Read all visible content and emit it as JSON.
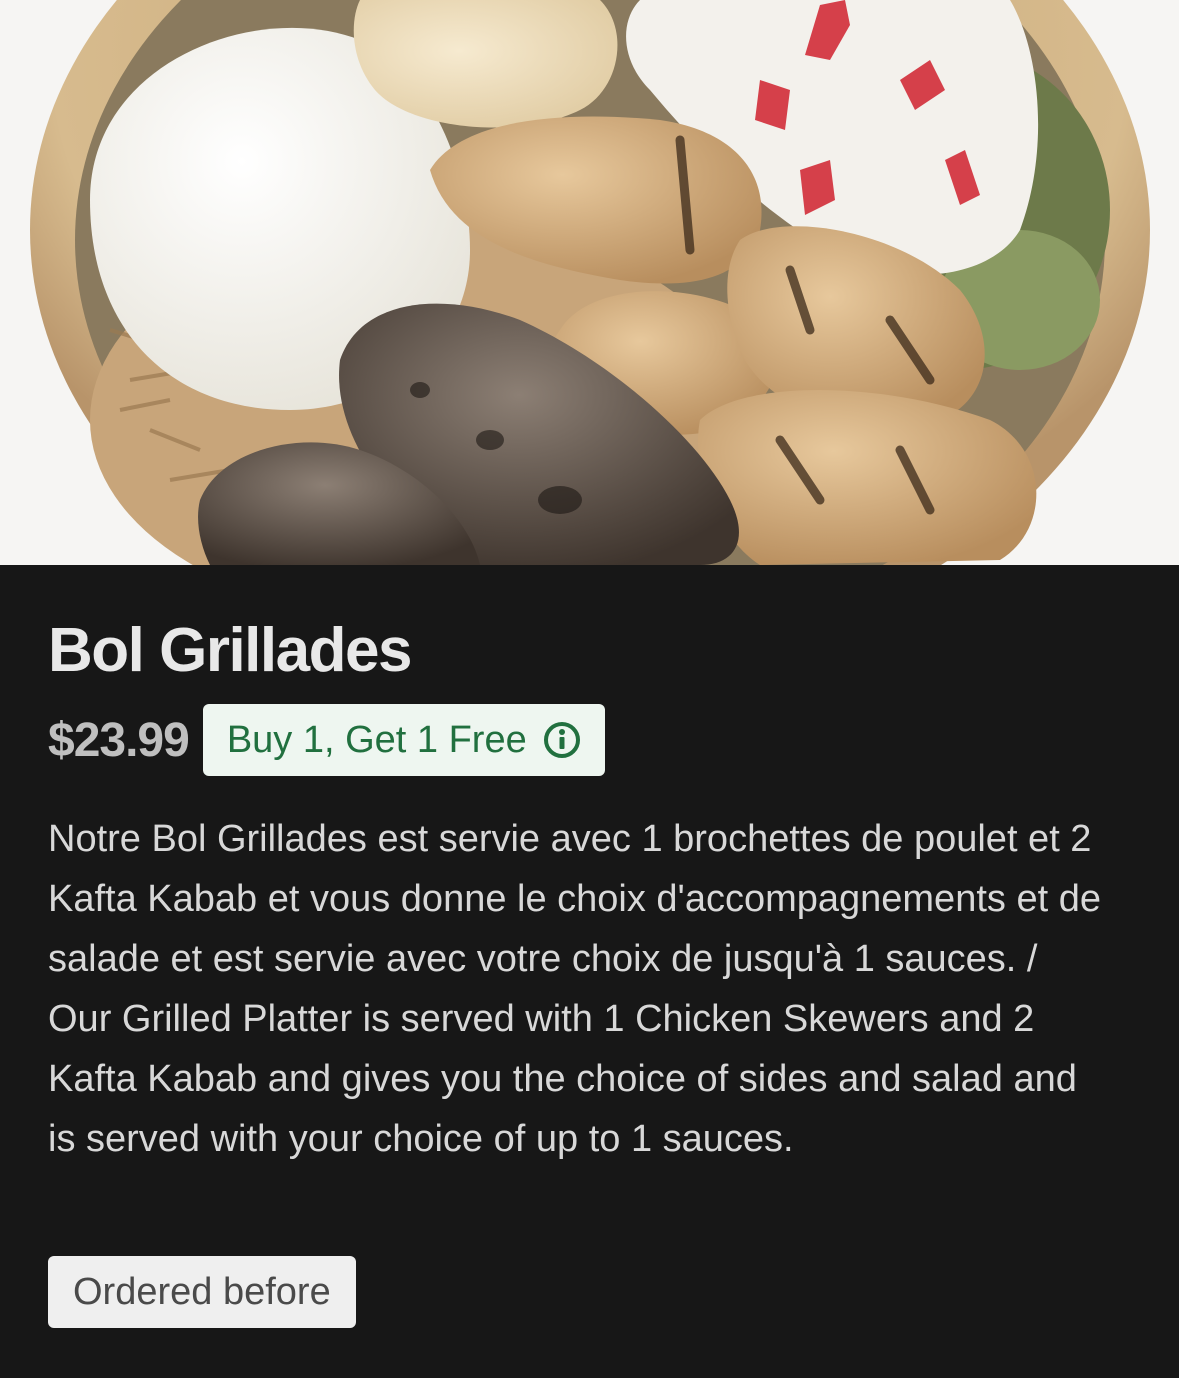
{
  "item": {
    "name": "Bol Grillades",
    "price": "$23.99",
    "promo_label": "Buy 1, Get 1 Free",
    "description": "Notre Bol Grillades est servie avec 1 brochettes de poulet et 2 Kafta Kabab et vous donne le choix d'accompagnements et de salade et est servie avec votre choix de jusqu'à 1 sauces. / Our Grilled Platter is served with 1 Chicken Skewers and 2 Kafta Kabab and gives you the choice of sides and salad and is served with your choice of up to 1 sauces.",
    "badge": "Ordered before"
  },
  "icons": {
    "promo_info": "info-circle-icon"
  },
  "colors": {
    "background": "#171717",
    "promo_bg": "#eef6f0",
    "promo_text": "#21703f",
    "badge_bg": "#efefef"
  }
}
